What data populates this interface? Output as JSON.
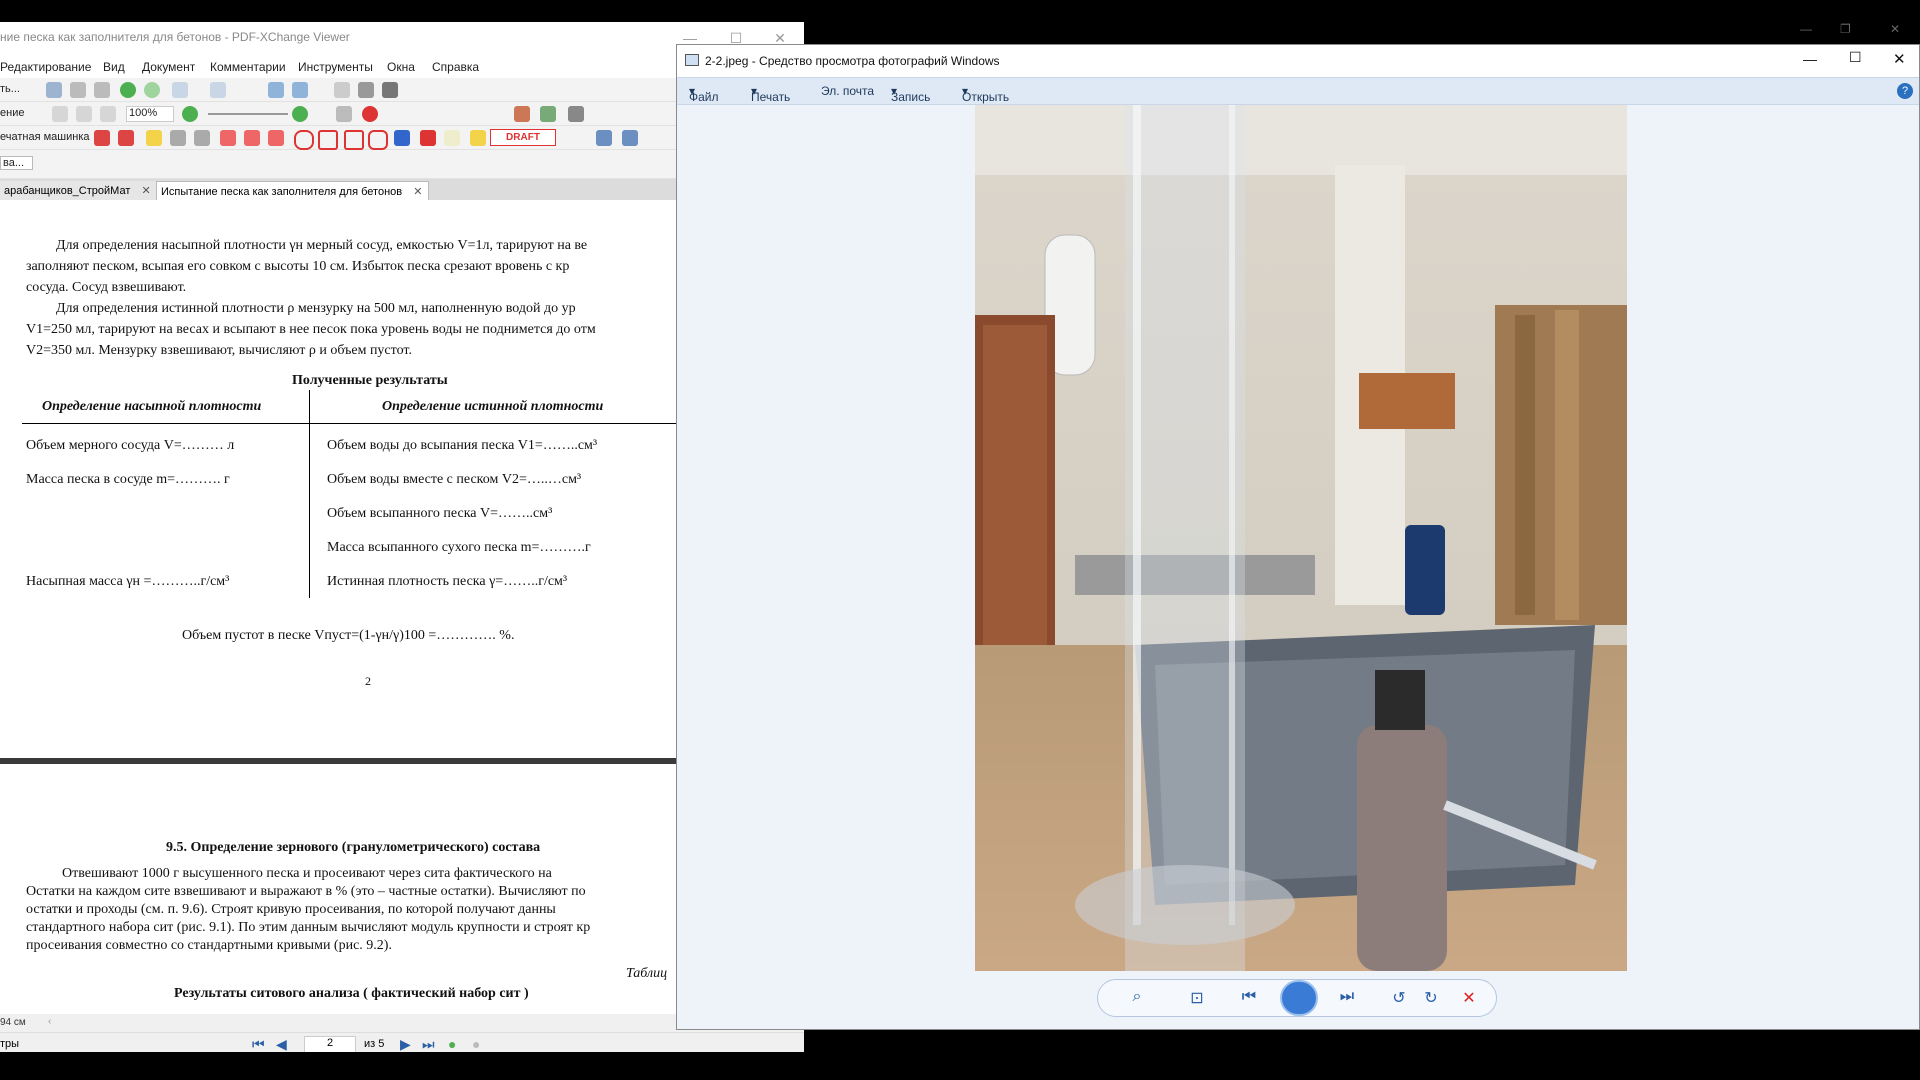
{
  "pdf": {
    "title": "ние песка как заполнителя для бетонов - PDF-XChange Viewer",
    "menu": [
      "Редактирование",
      "Вид",
      "Документ",
      "Комментарии",
      "Инструменты",
      "Окна",
      "Справка"
    ],
    "toolbar1": {
      "left_label": "ть..."
    },
    "toolbar2": {
      "left_label": "ение",
      "zoom": "100%"
    },
    "toolbar3": {
      "left_label": "ечатная машинка",
      "draft": "DRAFT"
    },
    "toolbar4": {
      "left_label": "ва..."
    },
    "tabs": [
      "арабанщиков_СтройМат",
      "Испытание песка как заполнителя для бетонов"
    ],
    "page": {
      "p1": "Для определения насыпной плотности γн  мерный сосуд, емкостью V=1л, тарируют на ве",
      "p2": "заполняют песком, всыпая его совком с высоты 10 см. Избыток песка срезают вровень с кр",
      "p3": "сосуда. Сосуд взвешивают.",
      "p4": "Для определения истинной плотности ρ мензурку на 500 мл, наполненную водой до ур",
      "p5": "V1=250 мл, тарируют на весах и всыпают в нее песок пока уровень воды не поднимется до отм",
      "p6": "V2=350 мл. Мензурку взвешивают, вычисляют ρ и объем пустот.",
      "results_title": "Полученные результаты",
      "col1": "Определение насыпной плотности",
      "col2": "Определение истинной плотности",
      "l1": "Объем мерного сосуда V=……… л",
      "l2": "Масса песка в сосуде   m=………. г",
      "l3": "Насыпная масса     γн =………..г/см³",
      "r1": "Объем воды до всыпания песка V1=……..см³",
      "r2": "Объем воды вместе с песком       V2=…..…см³",
      "r3": "Объем всыпанного песка              V=……..см³",
      "r4": "Масса всыпанного сухого песка  m=……….г",
      "r5": "Истинная плотность песка          γ=……..г/см³",
      "voids": "Объем пустот в песке Vпуст=(1-γн/γ)100 =………….  %.",
      "page_num": "2"
    },
    "page2": {
      "heading": "9.5. Определение зернового (гранулометрического) состава",
      "p1": "Отвешивают 1000 г высушенного песка и просеивают через сита фактического на",
      "p2": "Остатки на каждом сите взвешивают и выражают в % (это – частные остатки). Вычисляют по",
      "p3": "остатки и проходы (см. п. 9.6). Строят кривую просеивания, по которой получают данны",
      "p4": "стандартного набора сит (рис. 9.1). По этим данным вычисляют модуль крупности и строят кр",
      "p5": "просеивания совместно со стандартными кривыми (рис. 9.2).",
      "table_ref": "Таблиц",
      "table_title": "Результаты  ситового анализа ( фактический набор сит )"
    },
    "status": "94 см",
    "nav": {
      "left_label": "тры",
      "page": "2",
      "of": "из 5"
    }
  },
  "photo": {
    "title": "2-2.jpeg - Средство просмотра фотографий Windows",
    "menu": [
      "Файл",
      "Печать",
      "Эл. почта",
      "Запись",
      "Открыть"
    ]
  }
}
